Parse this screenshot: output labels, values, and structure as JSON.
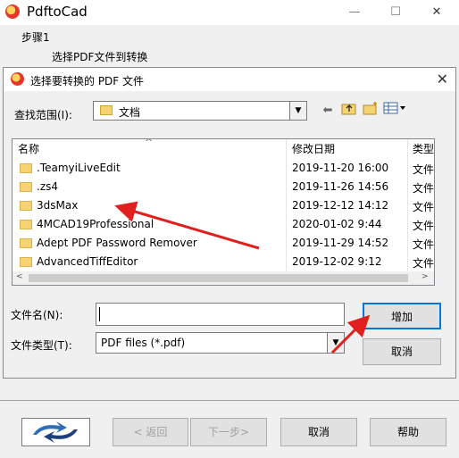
{
  "app": {
    "title": "PdftoCad"
  },
  "step": {
    "label": "步骤1",
    "description": "选择PDF文件到转换"
  },
  "window_controls": {
    "minimize": "—",
    "maximize": "☐",
    "close": "✕"
  },
  "dialog": {
    "title": "选择要转换的 PDF 文件",
    "close": "✕",
    "look_in_label": "查找范围(I):",
    "look_in_value": "文档",
    "columns": {
      "name": "名称",
      "date": "修改日期",
      "type": "类型"
    },
    "files": [
      {
        "name": ".TeamyiLiveEdit",
        "date": "2019-11-20 16:00",
        "type": "文件"
      },
      {
        "name": ".zs4",
        "date": "2019-11-26 14:56",
        "type": "文件"
      },
      {
        "name": "3dsMax",
        "date": "2019-12-12 14:12",
        "type": "文件"
      },
      {
        "name": "4MCAD19Professional",
        "date": "2020-01-02 9:44",
        "type": "文件"
      },
      {
        "name": "Adept PDF Password Remover",
        "date": "2019-11-29 14:52",
        "type": "文件"
      },
      {
        "name": "AdvancedTiffEditor",
        "date": "2019-12-02 9:12",
        "type": "文件"
      }
    ],
    "filename_label": "文件名(N):",
    "filename_value": "",
    "filetype_label": "文件类型(T):",
    "filetype_value": "PDF files (*.pdf)",
    "add_button": "增加",
    "cancel_button": "取消"
  },
  "wizard": {
    "back_button": "< 返回",
    "next_button": "下一步>",
    "cancel_button": "取消",
    "help_button": "帮助"
  },
  "colors": {
    "annotation_arrow": "#e0201e",
    "focus_border": "#0078d7"
  }
}
